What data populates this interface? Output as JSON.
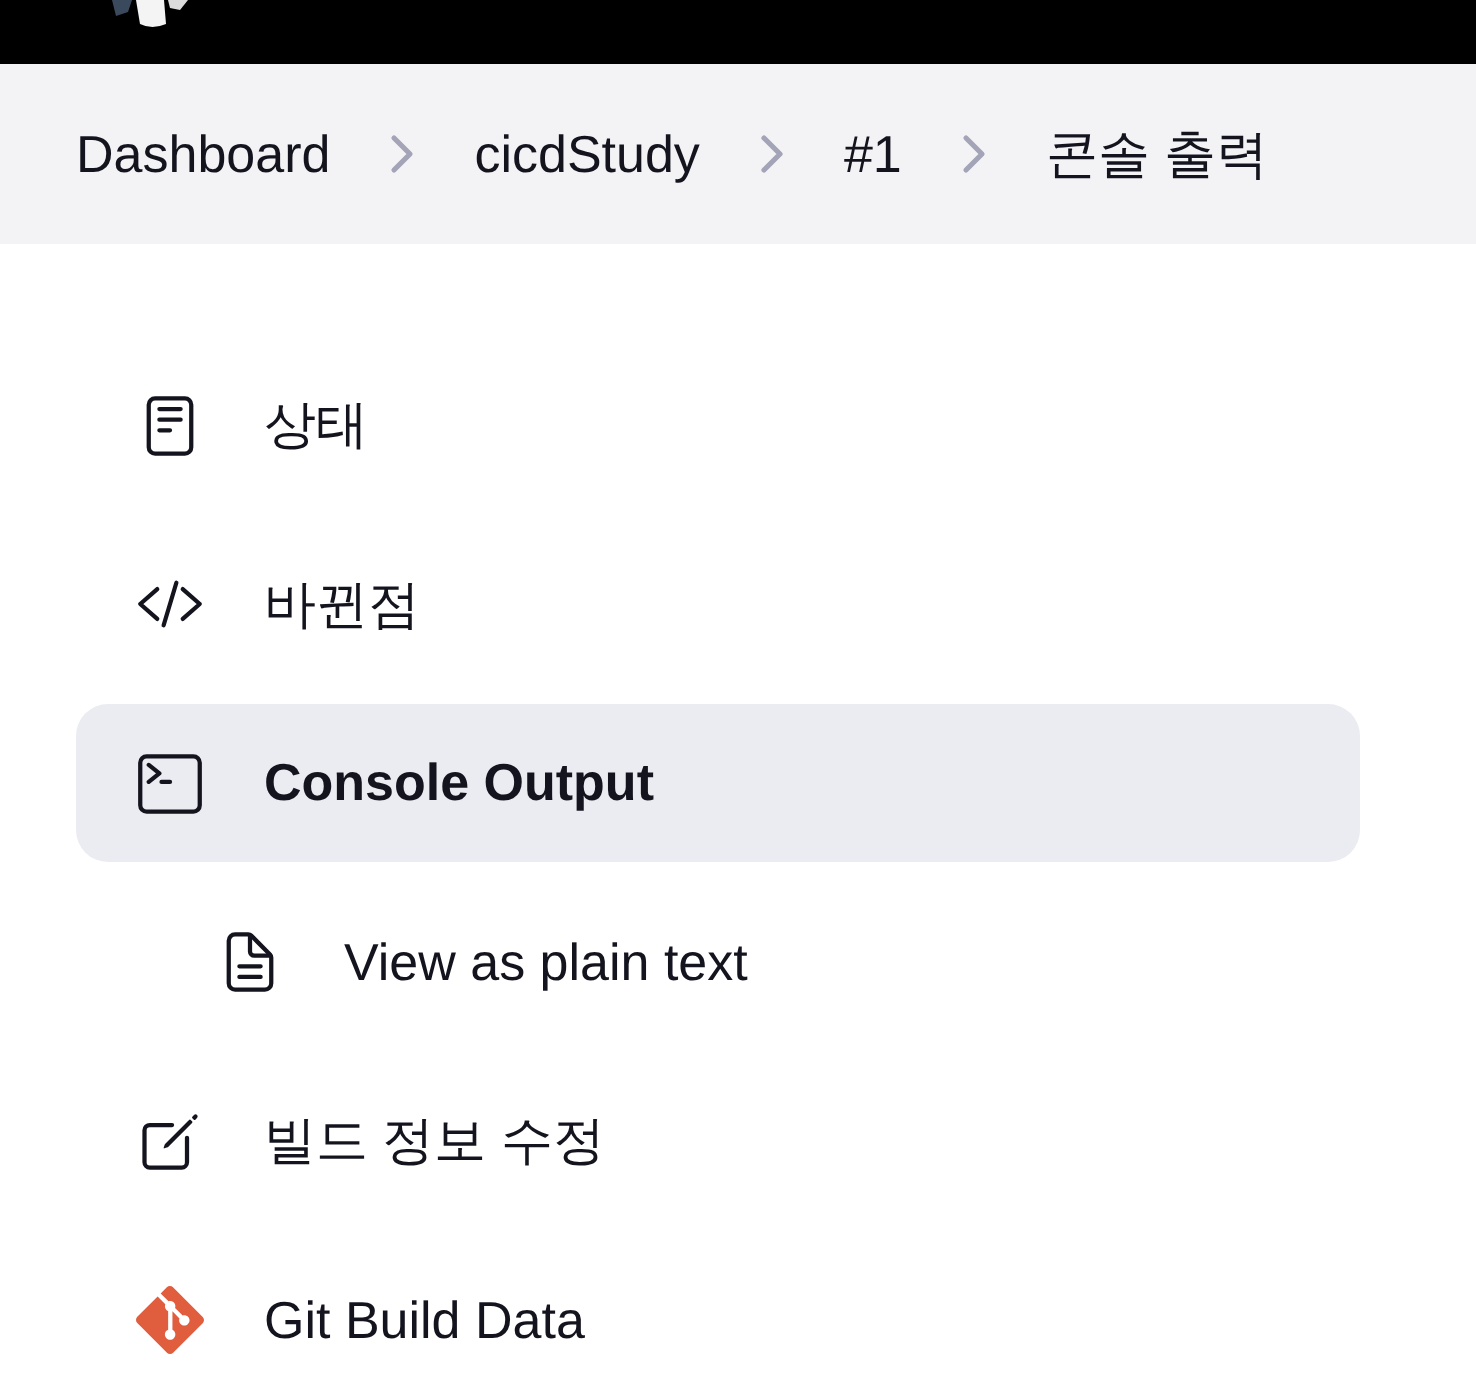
{
  "breadcrumbs": [
    "Dashboard",
    "cicdStudy",
    "#1",
    "콘솔 출력"
  ],
  "sidebar": {
    "items": [
      {
        "label": "상태",
        "kind": "status",
        "selected": false
      },
      {
        "label": "바뀐점",
        "kind": "changes",
        "selected": false
      },
      {
        "label": "Console Output",
        "kind": "console",
        "selected": true,
        "children": [
          {
            "label": "View as plain text",
            "kind": "plain",
            "selected": false
          }
        ]
      },
      {
        "label": "빌드 정보 수정",
        "kind": "edit",
        "selected": false
      },
      {
        "label": "Git Build Data",
        "kind": "git",
        "selected": false
      }
    ]
  }
}
